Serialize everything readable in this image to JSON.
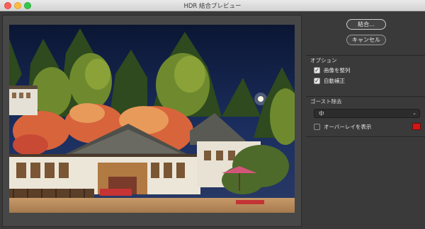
{
  "window": {
    "title": "HDR 結合プレビュー"
  },
  "buttons": {
    "ok": "結合...",
    "cancel": "キャンセル"
  },
  "options": {
    "heading": "オプション",
    "align_images": {
      "label": "画像を整列",
      "checked": true
    },
    "auto_tone": {
      "label": "自動補正",
      "checked": true
    }
  },
  "ghost": {
    "heading": "ゴースト除去",
    "select_value": "中",
    "overlay": {
      "label": "オーバーレイを表示",
      "checked": false
    },
    "overlay_color": "#d41616"
  },
  "preview": {
    "description_icon": "photo"
  },
  "colors": {
    "accent": "#d41616",
    "sky": "#0e1c3d"
  }
}
